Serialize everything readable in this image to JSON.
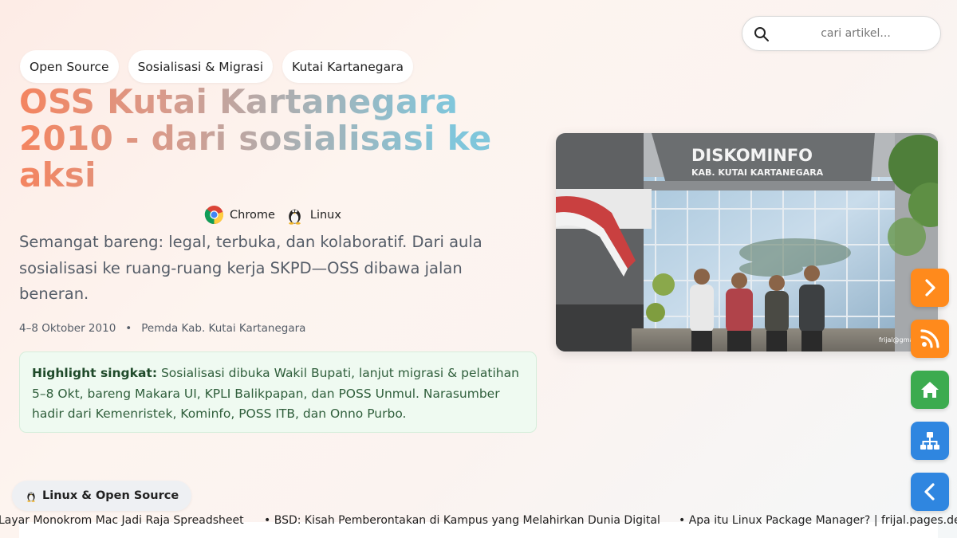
{
  "search": {
    "placeholder": "cari artikel..."
  },
  "tags": [
    "Open Source",
    "Sosialisasi & Migrasi",
    "Kutai Kartanegara"
  ],
  "title": "OSS Kutai Kartanegara 2010 - dari sosialisasi ke aksi",
  "badges": [
    {
      "label": "Chrome",
      "icon": "chrome-icon"
    },
    {
      "label": "Linux",
      "icon": "tux-icon"
    }
  ],
  "subtitle": "Semangat bareng: legal, terbuka, dan kolaboratif. Dari aula sosialisasi ke ruang-ruang kerja SKPD—OSS dibawa jalan beneran.",
  "meta": {
    "date": "4–8 Oktober 2010",
    "separator": "•",
    "place": "Pemda Kab. Kutai Kartanegara"
  },
  "highlight": {
    "label": "Highlight singkat:",
    "text": "Sosialisasi dibuka Wakil Bupati, lanjut migrasi & pelatihan 5–8 Okt, bareng Makara UI, KPLI Balikpapan, dan POSS Unmul. Narasumber hadir dari Kemenristek, Kominfo, POSS ITB, dan Onno Purbo."
  },
  "photo": {
    "sign_title": "DISKOMINFO",
    "sign_subtitle": "KAB. KUTAI KARTANEGARA",
    "credit": "frijal@gmail"
  },
  "side_buttons": [
    {
      "name": "next-button",
      "icon": "chevron-right-icon",
      "color": "#ff8a1c"
    },
    {
      "name": "rss-button",
      "icon": "rss-icon",
      "color": "#ff8a1c"
    },
    {
      "name": "home-button",
      "icon": "home-icon",
      "color": "#3cab4f"
    },
    {
      "name": "sitemap-button",
      "icon": "sitemap-icon",
      "color": "#2f86e0"
    },
    {
      "name": "prev-button",
      "icon": "chevron-left-icon",
      "color": "#2f86e0"
    }
  ],
  "category_pill": {
    "label": "Linux & Open Source",
    "icon": "tux-icon"
  },
  "ticker": [
    "Layar Monokrom Mac Jadi Raja Spreadsheet",
    "BSD: Kisah Pemberontakan di Kampus yang Melahirkan Dunia Digital",
    "Apa itu Linux Package Manager? | frijal.pages.dev"
  ],
  "ticker_bullet": "•"
}
